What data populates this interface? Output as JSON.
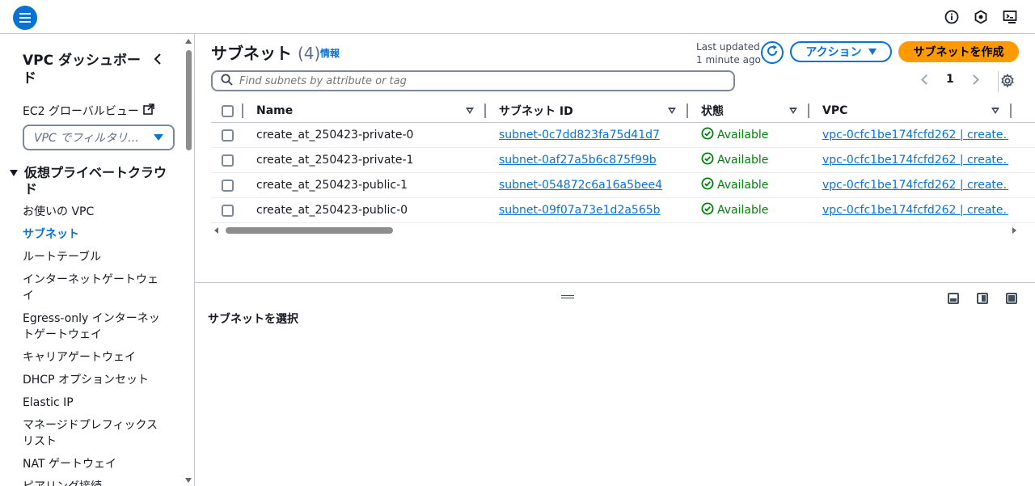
{
  "sidebar": {
    "title": "VPC ダッシュボード",
    "ec2_global": "EC2 グローバルビュー",
    "filter_placeholder": "VPC でフィルタリ…",
    "section": "仮想プライベートクラウド",
    "items": [
      {
        "label": "お使いの VPC",
        "active": false
      },
      {
        "label": "サブネット",
        "active": true
      },
      {
        "label": "ルートテーブル",
        "active": false
      },
      {
        "label": "インターネットゲートウェイ",
        "active": false
      },
      {
        "label": "Egress-only インターネットゲートウェイ",
        "active": false
      },
      {
        "label": "キャリアゲートウェイ",
        "active": false
      },
      {
        "label": "DHCP オプションセット",
        "active": false
      },
      {
        "label": "Elastic IP",
        "active": false
      },
      {
        "label": "マネージドプレフィックスリスト",
        "active": false
      },
      {
        "label": "NAT ゲートウェイ",
        "active": false
      },
      {
        "label": "ピアリング接続",
        "active": false
      }
    ]
  },
  "header": {
    "title": "サブネット",
    "count": "(4)",
    "info": "情報",
    "last_updated_1": "Last updated",
    "last_updated_2": "1 minute ago",
    "actions": "アクション",
    "create": "サブネットを作成",
    "search_placeholder": "Find subnets by attribute or tag",
    "page": "1"
  },
  "table": {
    "columns": [
      "Name",
      "サブネット ID",
      "状態",
      "VPC"
    ],
    "rows": [
      {
        "name": "create_at_250423-private-0",
        "subnet_id": "subnet-0c7dd823fa75d41d7",
        "state": "Available",
        "vpc": "vpc-0cfc1be174fcfd262 | create…"
      },
      {
        "name": "create_at_250423-private-1",
        "subnet_id": "subnet-0af27a5b6c875f99b",
        "state": "Available",
        "vpc": "vpc-0cfc1be174fcfd262 | create…"
      },
      {
        "name": "create_at_250423-public-1",
        "subnet_id": "subnet-054872c6a16a5bee4",
        "state": "Available",
        "vpc": "vpc-0cfc1be174fcfd262 | create…"
      },
      {
        "name": "create_at_250423-public-0",
        "subnet_id": "subnet-09f07a73e1d2a565b",
        "state": "Available",
        "vpc": "vpc-0cfc1be174fcfd262 | create…"
      }
    ]
  },
  "split_panel": {
    "title": "サブネットを選択"
  },
  "colors": {
    "primary": "#0972d3",
    "create_button": "#ff9900",
    "available": "#037f0c"
  }
}
